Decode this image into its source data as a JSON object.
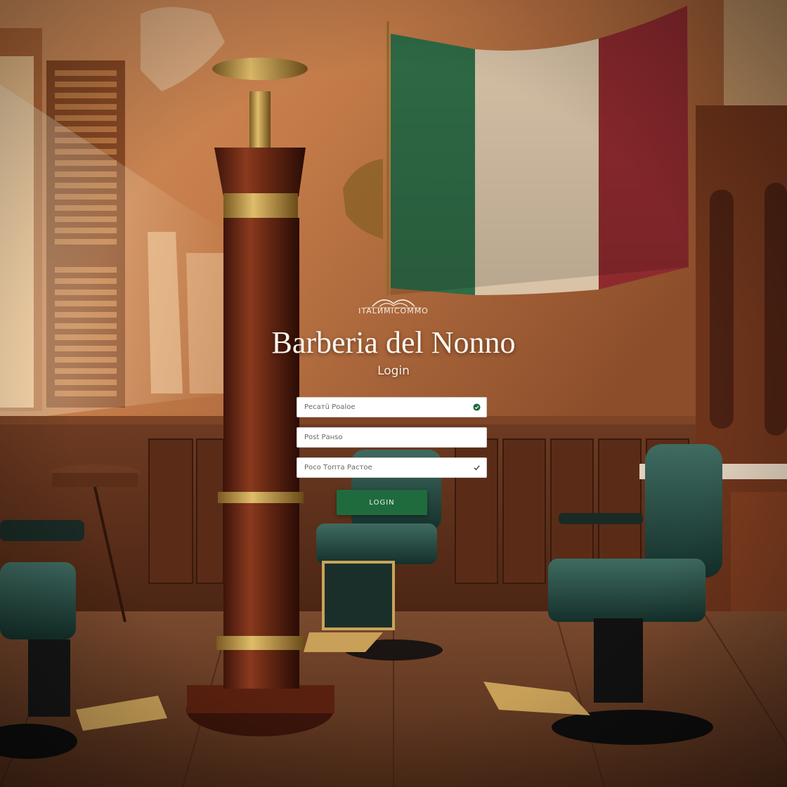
{
  "brand": {
    "caption": "ITALИMICOMMO"
  },
  "header": {
    "title": "Barberia del Nonno",
    "subtitle": "Login"
  },
  "form": {
    "fields": [
      {
        "placeholder": "Ресатü Роаlое",
        "icon": "status-check-icon"
      },
      {
        "placeholder": "Роst Ранsо",
        "icon": ""
      },
      {
        "placeholder": "Росо Топта Растое",
        "icon": "checkmark-icon"
      }
    ],
    "submit_label": "LOGIN"
  },
  "colors": {
    "accent": "#1f6b3e",
    "title": "#fbf6ee"
  }
}
